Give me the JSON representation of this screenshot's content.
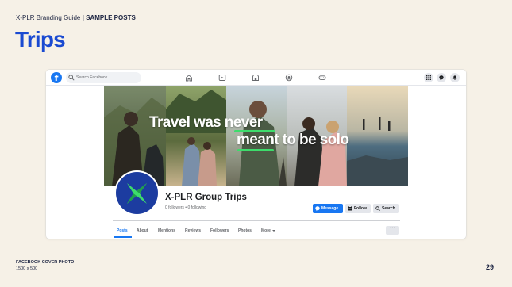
{
  "guide": {
    "brand": "X-PLR Branding Guide",
    "separator": "|",
    "section": "SAMPLE POSTS",
    "title": "Trips"
  },
  "facebook": {
    "search_placeholder": "Search Facebook",
    "nav_icons": [
      "home-icon",
      "video-icon",
      "marketplace-icon",
      "groups-icon",
      "gaming-icon"
    ],
    "right_icons": [
      "menu-grid-icon",
      "messenger-icon",
      "notifications-bell-icon"
    ],
    "cover": {
      "line1": "Travel was never",
      "line2": "meant to be solo",
      "accent_color": "#3ddc6b"
    },
    "profile": {
      "name": "X-PLR Group Trips",
      "followers": "0 followers",
      "dot": "•",
      "following": "0 following"
    },
    "actions": {
      "message": "Message",
      "follow": "Follow",
      "search": "Search"
    },
    "tabs": [
      "Posts",
      "About",
      "Mentions",
      "Reviews",
      "Followers",
      "Photos",
      "More"
    ],
    "active_tab": "Posts",
    "more_options_label": "···",
    "brand_color": "#1877f2"
  },
  "footer": {
    "caption_title": "FACEBOOK COVER PHOTO",
    "caption_size": "1500 x 500",
    "page_number": "29"
  }
}
